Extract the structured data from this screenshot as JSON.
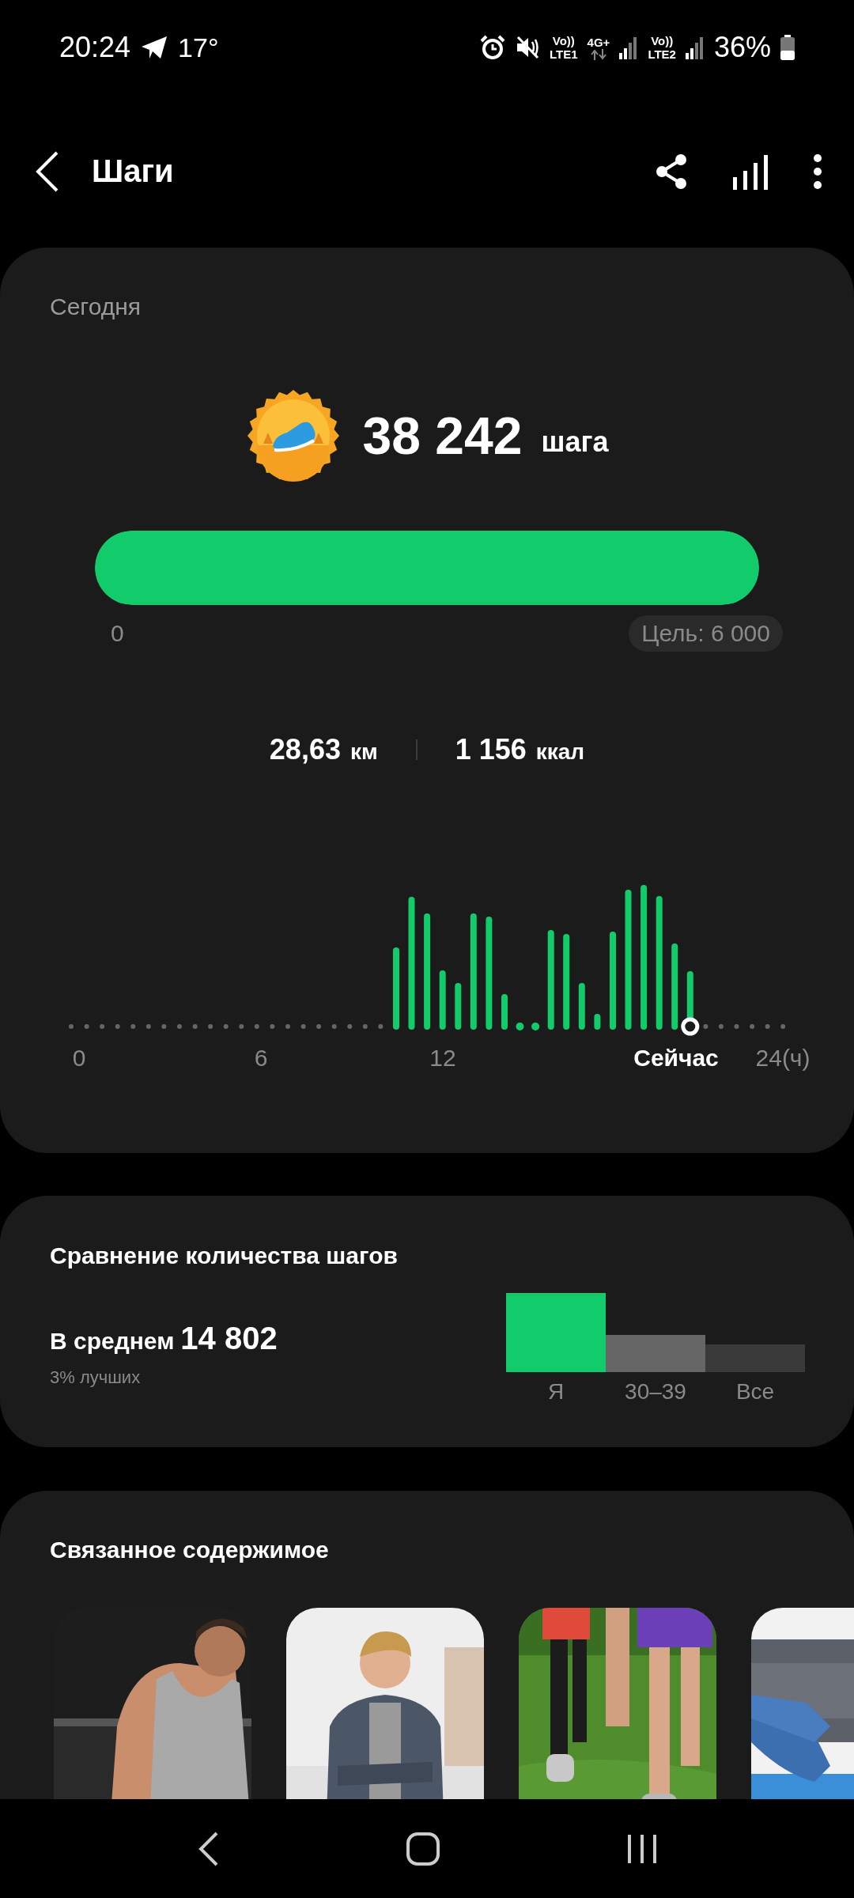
{
  "status_bar": {
    "time": "20:24",
    "temperature": "17°",
    "sim1": {
      "voice": "Vo))",
      "network": "LTE1"
    },
    "data_type": "4G+",
    "sim2": {
      "voice": "Vo))",
      "network": "LTE2"
    },
    "battery": "36%"
  },
  "header": {
    "title": "Шаги"
  },
  "today": {
    "label": "Сегодня",
    "steps": "38 242",
    "unit": "шага",
    "progress": {
      "level": 1,
      "start": "0",
      "goal": "Цель: 6 000"
    },
    "stats": [
      {
        "value": "28,63",
        "unit": "км"
      },
      {
        "value": "1 156",
        "unit": "ккал"
      }
    ],
    "hourly_axis": [
      {
        "label": "0",
        "kind": "tick"
      },
      {
        "label": "6",
        "kind": "tick"
      },
      {
        "label": "12",
        "kind": "tick"
      },
      {
        "label": "Сейчас",
        "kind": "current"
      },
      {
        "label": "24(ч)",
        "kind": "tick"
      }
    ]
  },
  "comparison": {
    "title": "Сравнение количества шагов",
    "average_label": "В среднем",
    "average_value": "14 802",
    "rank": "3% лучших",
    "groups": [
      {
        "label": "Я",
        "color": "#12cc6c"
      },
      {
        "label": "30–39",
        "color": "#666666"
      },
      {
        "label": "Все",
        "color": "#3a3a3a"
      }
    ]
  },
  "related": {
    "title": "Связанное содержимое"
  }
}
